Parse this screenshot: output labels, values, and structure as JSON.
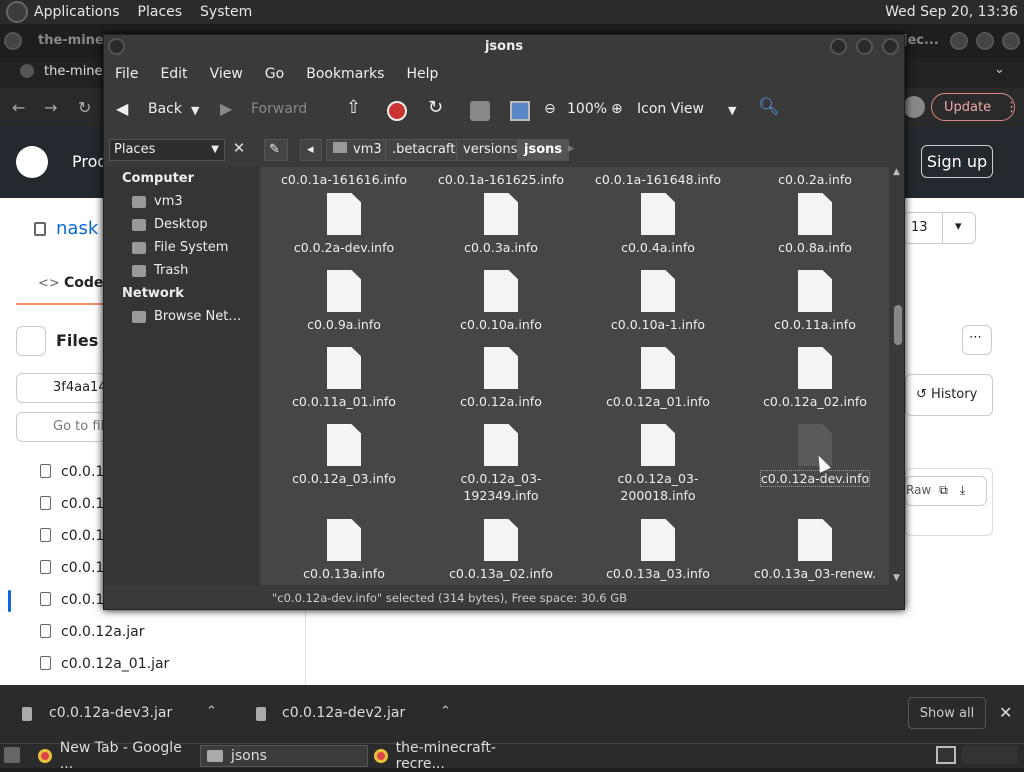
{
  "top_panel": {
    "menus": [
      "Applications",
      "Places",
      "System"
    ],
    "clock": "Wed Sep 20, 13:36"
  },
  "chrome": {
    "tab_title": "the-minecraft-recre...",
    "tab_title_2": "the-minec",
    "bg_tab_fragment": "the-minec",
    "bg_right_fragment": "jec...",
    "update_label": "Update",
    "colors": {
      "accent": "#0969da",
      "header": "#24292f"
    }
  },
  "github": {
    "header_product": "Prod",
    "signup": "Sign up",
    "repo_fragment": "nask",
    "code_tab": "Code",
    "files_title": "Files",
    "branch": "3f4aa14",
    "goto_placeholder": "Go to fil",
    "star_count": "13",
    "history": "History",
    "raw": "Raw",
    "files": [
      "c0.0.1",
      "c0.0.1",
      "c0.0.1",
      "c0.0.1",
      "c0.0.1",
      "c0.0.12a.jar",
      "c0.0.12a_01.jar"
    ]
  },
  "caja": {
    "title": "jsons",
    "menu": [
      "File",
      "Edit",
      "View",
      "Go",
      "Bookmarks",
      "Help"
    ],
    "toolbar": {
      "back": "Back",
      "forward": "Forward",
      "zoom": "100%",
      "view_mode": "Icon View"
    },
    "places_label": "Places",
    "breadcrumbs": [
      "vm3",
      ".betacraft",
      "versions",
      "jsons"
    ],
    "sidebar": {
      "computer_heading": "Computer",
      "computer_items": [
        "vm3",
        "Desktop",
        "File System",
        "Trash"
      ],
      "network_heading": "Network",
      "network_items": [
        "Browse Net…"
      ]
    },
    "files_row0": [
      "c0.0.1a-161616.info",
      "c0.0.1a-161625.info",
      "c0.0.1a-161648.info",
      "c0.0.2a.info"
    ],
    "files": [
      [
        "c0.0.2a-dev.info",
        "c0.0.3a.info",
        "c0.0.4a.info",
        "c0.0.8a.info"
      ],
      [
        "c0.0.9a.info",
        "c0.0.10a.info",
        "c0.0.10a-1.info",
        "c0.0.11a.info"
      ],
      [
        "c0.0.11a_01.info",
        "c0.0.12a.info",
        "c0.0.12a_01.info",
        "c0.0.12a_02.info"
      ],
      [
        "c0.0.12a_03.info",
        "c0.0.12a_03-192349.info",
        "c0.0.12a_03-200018.info",
        "c0.0.12a-dev.info"
      ],
      [
        "c0.0.13a.info",
        "c0.0.13a_02.info",
        "c0.0.13a_03.info",
        "c0.0.13a_03-renew."
      ]
    ],
    "selected": "c0.0.12a-dev.info",
    "status": "\"c0.0.12a-dev.info\" selected (314 bytes), Free space: 30.6 GB"
  },
  "downloads": {
    "items": [
      "c0.0.12a-dev3.jar",
      "c0.0.12a-dev2.jar"
    ],
    "show_all": "Show all"
  },
  "taskbar": {
    "tasks": [
      "New Tab - Google ...",
      "jsons",
      "the-minecraft-recre..."
    ]
  }
}
